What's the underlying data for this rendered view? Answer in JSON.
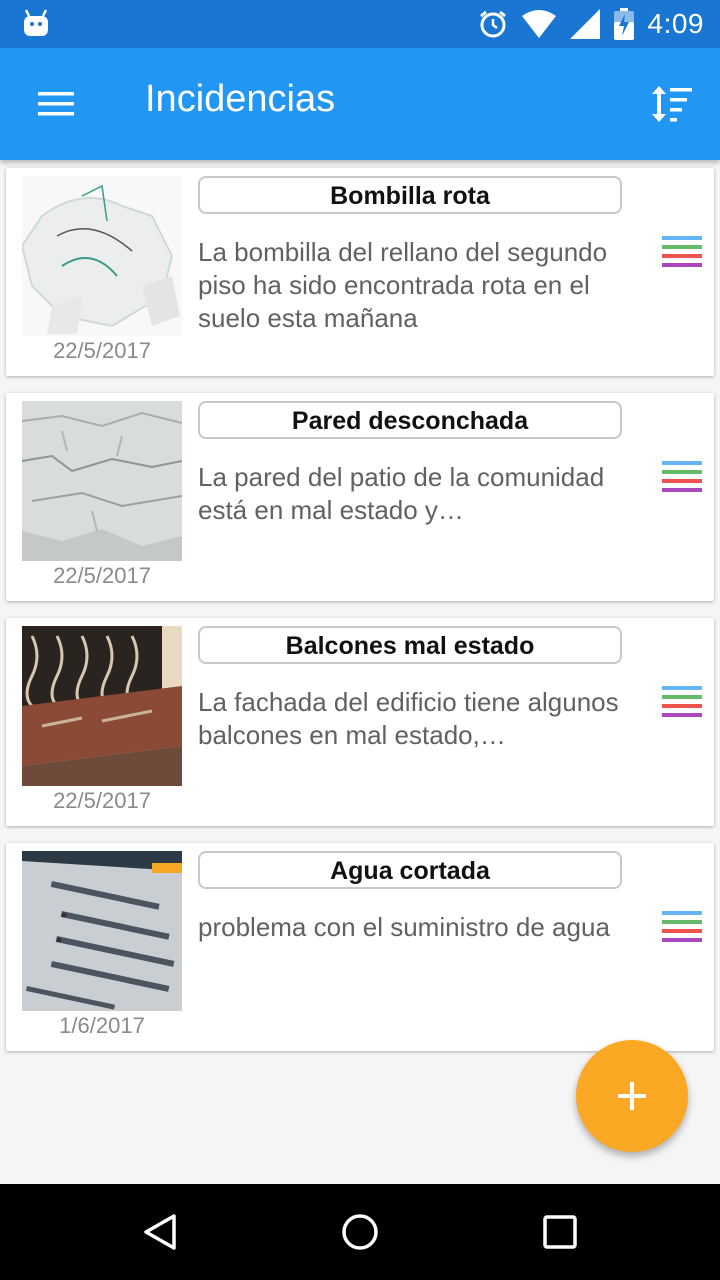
{
  "status_bar": {
    "time": "4:09"
  },
  "app_bar": {
    "title": "Incidencias",
    "menu_icon": "hamburger-menu-icon",
    "sort_icon": "sort-icon"
  },
  "incidents": [
    {
      "title": "Bombilla rota",
      "description": "La bombilla del rellano del segundo piso ha sido encontrada rota en el suelo esta mañana",
      "date": "22/5/2017",
      "image": "broken-bulb-photo"
    },
    {
      "title": "Pared desconchada",
      "description": "La pared del patio de la comunidad está en mal estado y…",
      "date": "22/5/2017",
      "image": "peeling-wall-photo"
    },
    {
      "title": "Balcones mal estado",
      "description": "La fachada del edificio tiene algunos balcones en mal estado,…",
      "date": "22/5/2017",
      "image": "balcony-photo"
    },
    {
      "title": "Agua cortada",
      "description": "problema con el suministro de agua",
      "date": "1/6/2017",
      "image": "screen-code-photo"
    }
  ],
  "tag_colors": [
    "#64b5f6",
    "#66bb6a",
    "#ef5350",
    "#ab47bc"
  ],
  "fab": {
    "icon": "add-icon",
    "color": "#fba925"
  },
  "colors": {
    "primary": "#2196f3",
    "primary_dark": "#1976d2"
  }
}
